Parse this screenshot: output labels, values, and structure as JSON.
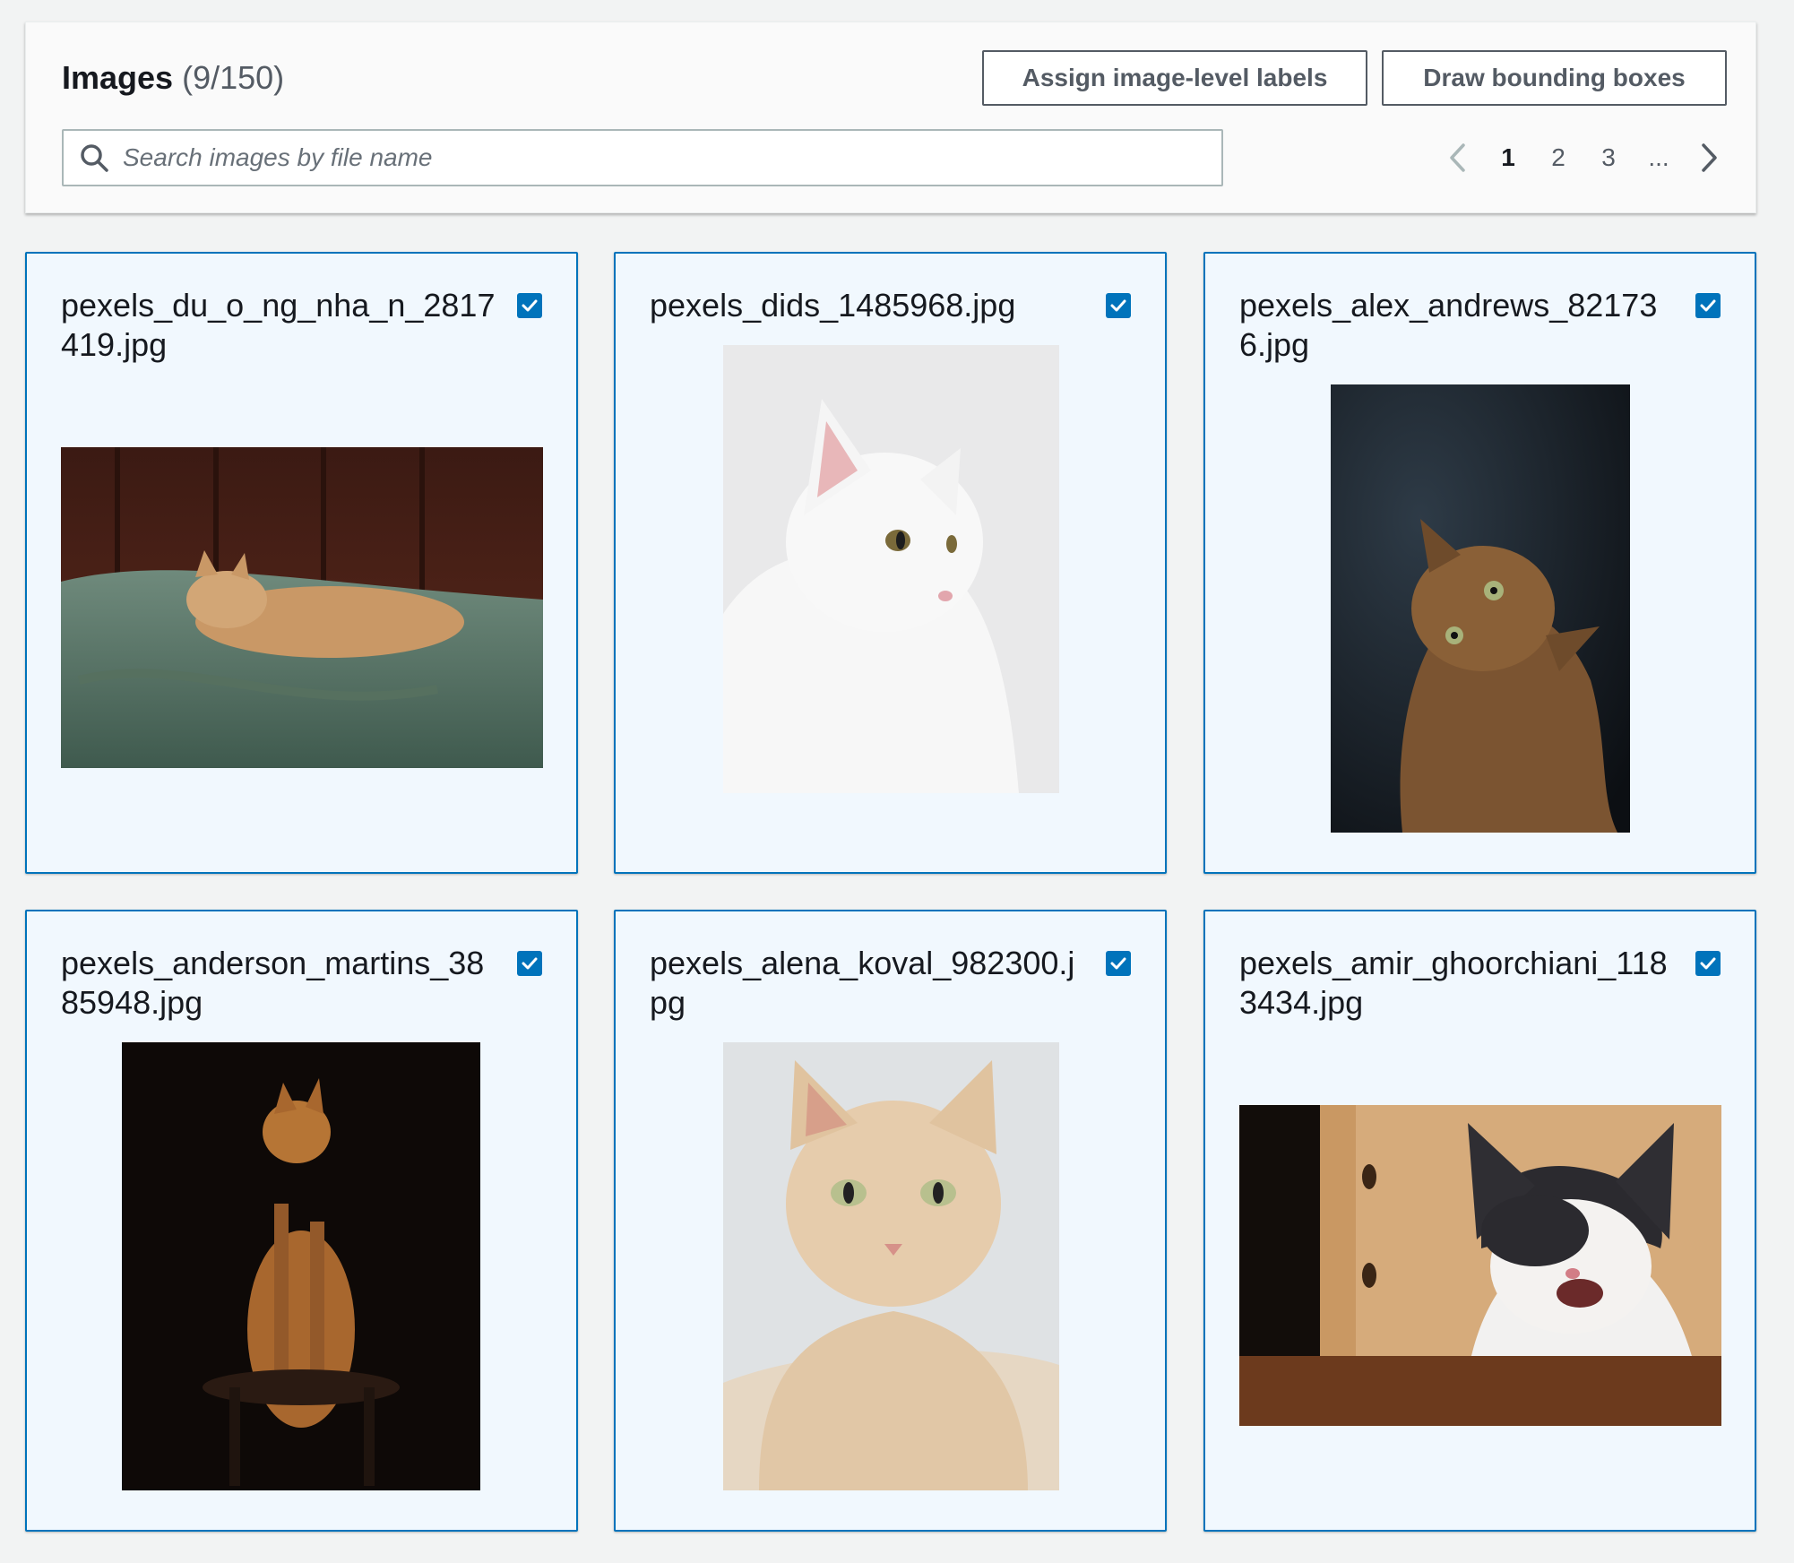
{
  "header": {
    "title": "Images",
    "count": "(9/150)",
    "assign_label": "Assign image-level labels",
    "draw_label": "Draw bounding boxes"
  },
  "search": {
    "placeholder": "Search images by file name",
    "value": ""
  },
  "pagination": {
    "pages": [
      "1",
      "2",
      "3"
    ],
    "current": "1",
    "ellipsis": "..."
  },
  "cards": [
    {
      "filename": "pexels_du_o_ng_nha_n_2817419.jpg",
      "checked": true,
      "image": "sleeping-orange-cat-on-green-sheets"
    },
    {
      "filename": "pexels_dids_1485968.jpg",
      "checked": true,
      "image": "white-cat-portrait"
    },
    {
      "filename": "pexels_alex_andrews_821736.jpg",
      "checked": true,
      "image": "brown-cat-looking-up"
    },
    {
      "filename": "pexels_anderson_martins_3885948.jpg",
      "checked": true,
      "image": "orange-cat-on-stool-dark"
    },
    {
      "filename": "pexels_alena_koval_982300.jpg",
      "checked": true,
      "image": "cream-cat-on-knit-blanket"
    },
    {
      "filename": "pexels_amir_ghoorchiani_1183434.jpg",
      "checked": true,
      "image": "black-white-kitten-yawning"
    }
  ],
  "colors": {
    "accent": "#0073bb",
    "card_bg": "#f1f8fe",
    "page_bg": "#f2f3f3"
  }
}
